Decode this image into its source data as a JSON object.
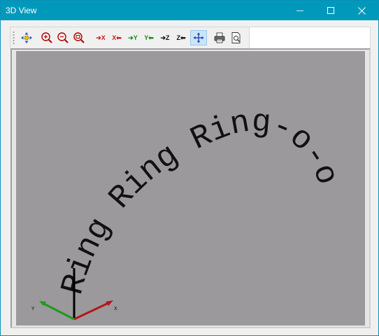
{
  "window": {
    "title": "3D View",
    "controls": {
      "minimize": "minimize",
      "maximize": "maximize",
      "close": "close"
    }
  },
  "toolbar": {
    "buttons": [
      {
        "name": "pan",
        "icon": "pan-arrows-icon"
      },
      {
        "name": "zoom-in",
        "icon": "zoom-in-icon"
      },
      {
        "name": "zoom-out",
        "icon": "zoom-out-icon"
      },
      {
        "name": "zoom-fit",
        "icon": "zoom-fit-icon"
      },
      {
        "name": "view-pos-x",
        "label": "X",
        "icon": "arrow-right-icon"
      },
      {
        "name": "view-neg-x",
        "label": "X",
        "icon": "arrow-left-icon"
      },
      {
        "name": "view-pos-y",
        "label": "Y",
        "icon": "arrow-right-icon"
      },
      {
        "name": "view-neg-y",
        "label": "Y",
        "icon": "arrow-left-icon"
      },
      {
        "name": "view-pos-z",
        "label": "Z",
        "icon": "arrow-right-icon"
      },
      {
        "name": "view-neg-z",
        "label": "Z",
        "icon": "arrow-left-icon"
      },
      {
        "name": "rotate",
        "icon": "rotate-icon",
        "active": true
      },
      {
        "name": "print",
        "icon": "printer-icon"
      },
      {
        "name": "print-preview",
        "icon": "print-preview-icon"
      }
    ]
  },
  "viewport": {
    "text": "Ring Ring Ring-o-o",
    "background": "#9b999b",
    "axes": {
      "x": "X",
      "y": "Y"
    },
    "colors": {
      "x": "#b01818",
      "y": "#1e9a1e",
      "z": "#000000"
    }
  }
}
